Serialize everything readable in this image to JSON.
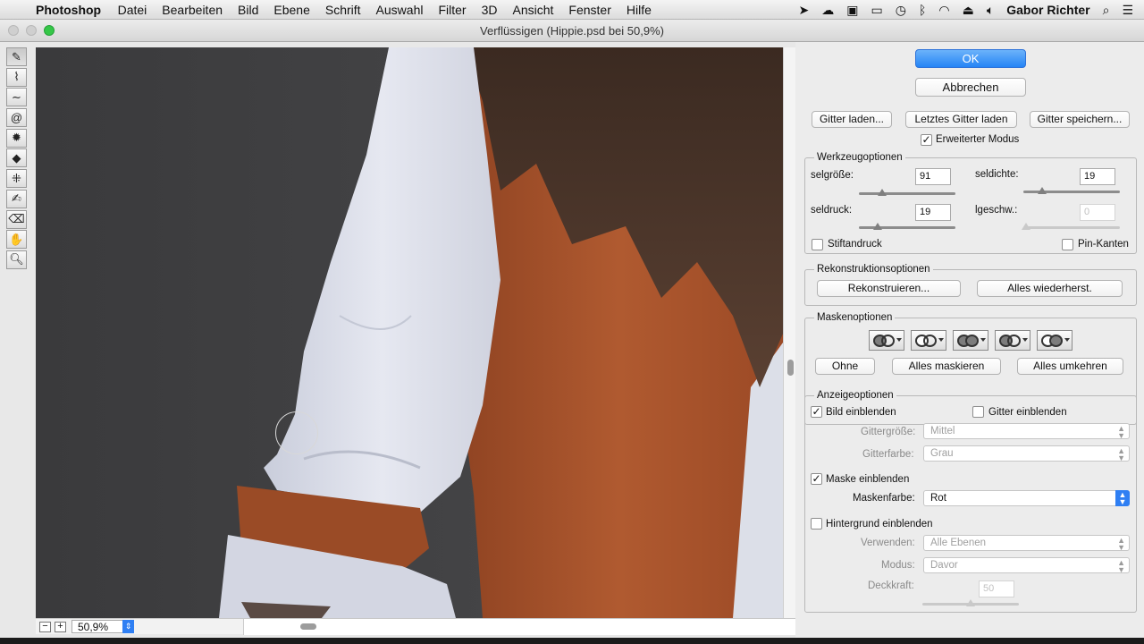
{
  "menubar": {
    "app": "Photoshop",
    "items": [
      "Datei",
      "Bearbeiten",
      "Bild",
      "Ebene",
      "Schrift",
      "Auswahl",
      "Filter",
      "3D",
      "Ansicht",
      "Fenster",
      "Hilfe"
    ],
    "user": "Gabor Richter"
  },
  "window": {
    "title": "Verflüssigen (Hippie.psd bei 50,9%)"
  },
  "status": {
    "zoom": "50,9%",
    "zoom_out": "−",
    "zoom_in": "+"
  },
  "tools": [
    "forward-warp",
    "reconstruct",
    "smooth",
    "twirl",
    "pucker",
    "bloat",
    "push-left",
    "freeze-mask",
    "thaw-mask",
    "hand",
    "zoom"
  ],
  "panel": {
    "ok": "OK",
    "cancel": "Abbrechen",
    "load_mesh": "Gitter laden...",
    "load_last_mesh": "Letztes Gitter laden",
    "save_mesh": "Gitter speichern...",
    "advanced_mode": "Erweiterter Modus",
    "tool_options": {
      "title": "Werkzeugoptionen",
      "size_label": "selgröße:",
      "size_value": "91",
      "density_label": "seldichte:",
      "density_value": "19",
      "pressure_label": "seldruck:",
      "pressure_value": "19",
      "rate_label": "lgeschw.:",
      "rate_value": "0",
      "stylus": "Stiftandruck",
      "pin_edges": "Pin-Kanten"
    },
    "reconstruct_options": {
      "title": "Rekonstruktionsoptionen",
      "reconstruct": "Rekonstruieren...",
      "restore_all": "Alles wiederherst."
    },
    "mask_options": {
      "title": "Maskenoptionen",
      "none": "Ohne",
      "mask_all": "Alles maskieren",
      "invert_all": "Alles umkehren"
    },
    "view_options": {
      "title": "Anzeigeoptionen",
      "show_image": "Bild einblenden",
      "show_mesh": "Gitter einblenden",
      "mesh_size_label": "Gittergröße:",
      "mesh_size": "Mittel",
      "mesh_color_label": "Gitterfarbe:",
      "mesh_color": "Grau",
      "show_mask": "Maske einblenden",
      "mask_color_label": "Maskenfarbe:",
      "mask_color": "Rot",
      "show_backdrop": "Hintergrund einblenden",
      "use_label": "Verwenden:",
      "use": "Alle Ebenen",
      "mode_label": "Modus:",
      "mode": "Davor",
      "opacity_label": "Deckkraft:",
      "opacity": "50"
    }
  },
  "colors": {
    "accent": "#2f7ff3",
    "traffic_green": "#35c748",
    "sleeve": "#d9dce8",
    "scarf": "#a4512a",
    "backdrop": "#3f3f41"
  }
}
